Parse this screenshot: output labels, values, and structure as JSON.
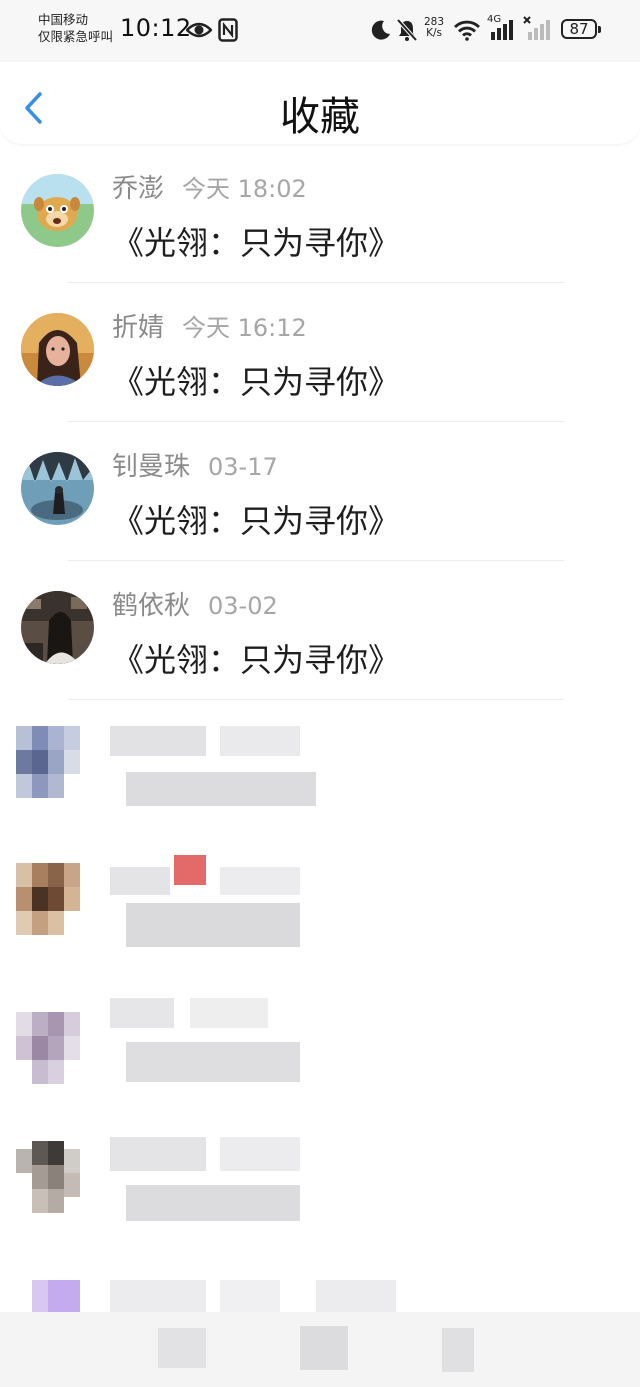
{
  "status_bar": {
    "carrier_line1": "中国移动",
    "carrier_line2": "仅限紧急呼叫",
    "time": "10:12",
    "net_speed_value": "283",
    "net_speed_unit": "K/s",
    "network_type": "4G",
    "battery": "87"
  },
  "header": {
    "title": "收藏"
  },
  "favorites": [
    {
      "name": "乔澎",
      "time": "今天 18:02",
      "message": "《光翎：只为寻你》"
    },
    {
      "name": "折婧",
      "time": "今天 16:12",
      "message": "《光翎：只为寻你》"
    },
    {
      "name": "钊曼珠",
      "time": "03-17",
      "message": "《光翎：只为寻你》"
    },
    {
      "name": "鹤依秋",
      "time": "03-02",
      "message": "《光翎：只为寻你》"
    }
  ],
  "colors": {
    "accent": "#3a8ee6",
    "name_gray": "#8a8a8a",
    "time_gray": "#a6a6a6"
  }
}
